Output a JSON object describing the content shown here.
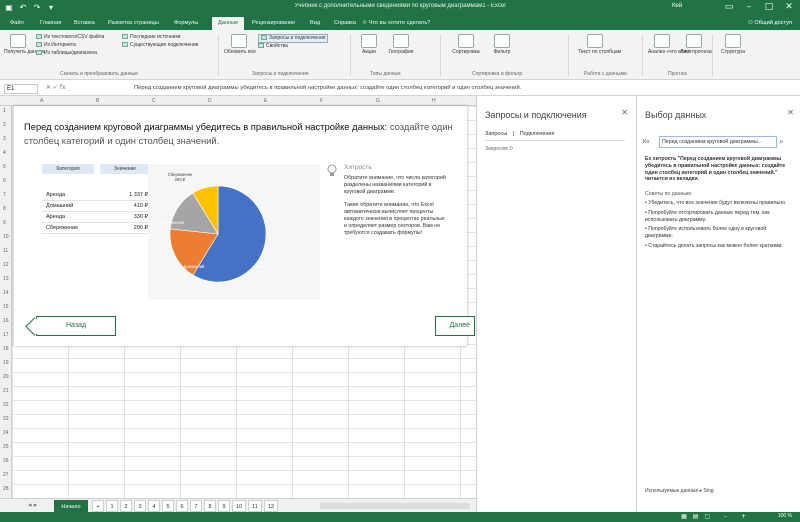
{
  "app": {
    "title": "Учебник с дополнительными сведениями по круговым диаграммам1 - Excel",
    "user": "Кей",
    "share_label": "Общий доступ"
  },
  "tabs": [
    "Файл",
    "Главная",
    "Вставка",
    "Разметка страницы",
    "Формулы",
    "Данные",
    "Рецензирование",
    "Вид",
    "Справка"
  ],
  "active_tab": "Данные",
  "tell_me": "Что вы хотите сделать?",
  "ribbon": {
    "get_data": "Получить данные",
    "from_text": "Из текстового/CSV файла",
    "from_web": "Из Интернета",
    "from_table": "Из таблицы/диапазона",
    "recent_sources": "Последние источники",
    "existing_connections": "Существующие подключения",
    "refresh_all": "Обновить все",
    "queries_connections": "Запросы и подключения",
    "properties": "Свойства",
    "stocks": "Акции",
    "geography": "География",
    "sort": "Сортировка",
    "filter": "Фильтр",
    "text_to_columns": "Текст по столбцам",
    "what_if": "Анализ «что если»",
    "forecast_sheet": "Лист прогноза",
    "outline": "Структура",
    "group_get": "Скачать и преобразовать данные",
    "group_queries": "Запросы и подключения",
    "group_types": "Типы данных",
    "group_sort": "Сортировка и фильтр",
    "group_tools": "Работа с данными",
    "group_forecast": "Прогноз"
  },
  "formula_bar": {
    "cell": "E1",
    "formula": "Перед созданием круговой диаграммы убедитесь в правильной настройке данных: создайте один столбец категорий и один столбец значений."
  },
  "grid": {
    "columns": [
      "A",
      "B",
      "C",
      "D",
      "E",
      "F",
      "G",
      "H",
      "I"
    ],
    "rows": [
      "1",
      "2",
      "3",
      "4",
      "5",
      "6",
      "7",
      "8",
      "9",
      "10",
      "11",
      "12",
      "13",
      "14",
      "15",
      "16",
      "17",
      "18",
      "19",
      "20",
      "21",
      "22",
      "23",
      "24",
      "25",
      "26",
      "27",
      "28"
    ]
  },
  "card": {
    "title_bold": "Перед созданием круговой диаграммы убедитесь в правильной настройке данных:",
    "title_rest": " создайте один столбец категорий и один столбец значений.",
    "table_headers": [
      "Категория",
      "Значение"
    ],
    "table_rows": [
      [
        "Аренда",
        "1 337 ₽"
      ],
      [
        "Домашний",
        "410 ₽"
      ],
      [
        "Аренда",
        "330 ₽"
      ],
      [
        "Сбережение",
        "200 ₽"
      ]
    ],
    "tip_title": "Хитрость",
    "tip_p1": "Обратите внимание, что числа категорий разделены названиями категорий в круговой диаграмме.",
    "tip_p2": "Также обратите внимание, что Excel автоматически вычисляет проценты каждого значения в процентах реальных и определяет размер секторов. Вам не требуются создавать формулы!",
    "back_label": "Назад",
    "next_label": "Далее"
  },
  "chart_data": {
    "type": "pie",
    "categories": [
      "Аренда",
      "Домашний",
      "Аренда",
      "Сбережение"
    ],
    "values": [
      1337,
      410,
      330,
      200
    ],
    "colors": [
      "#4472c4",
      "#ed7d31",
      "#a5a5a5",
      "#ffc000"
    ],
    "labels": [
      "Аренда",
      "Домашний",
      "Сбережение",
      "Сбережение"
    ],
    "label_values": [
      "",
      "",
      "",
      "200 ₽"
    ]
  },
  "sheets": {
    "active": "Начало",
    "tabs": [
      "Начало",
      "1",
      "2",
      "3",
      "4",
      "5",
      "6",
      "7",
      "8",
      "9",
      "10",
      "11",
      "12"
    ]
  },
  "status": {
    "zoom": "100 %"
  },
  "queries_pane": {
    "title": "Запросы и подключения",
    "tab_queries": "Запросы",
    "tab_connections": "Подключения",
    "count": "Запросов: 0"
  },
  "data_pane": {
    "title": "Выбор данных",
    "search_label": "Ко",
    "search_value": "Перед созданием круговой диаграммы...",
    "lead": "Ex хитрость \"Перед созданием круговой диаграммы убедитесь в правильной настройке данных: создайте один столбец категорий и один столбец значений.\" читается из вкладки.",
    "list_title": "Советы по данным:",
    "items": [
      "Убедитесь, что все значения будут включены правильно.",
      "Попробуйте отсортировать данные перед тем, как использовать диаграмму.",
      "Попробуйте использовать более одну в круговой диаграмме.",
      "Старайтесь делать запросы как можно более краткими."
    ],
    "footer": "Используемые данные ▸ Sing"
  }
}
